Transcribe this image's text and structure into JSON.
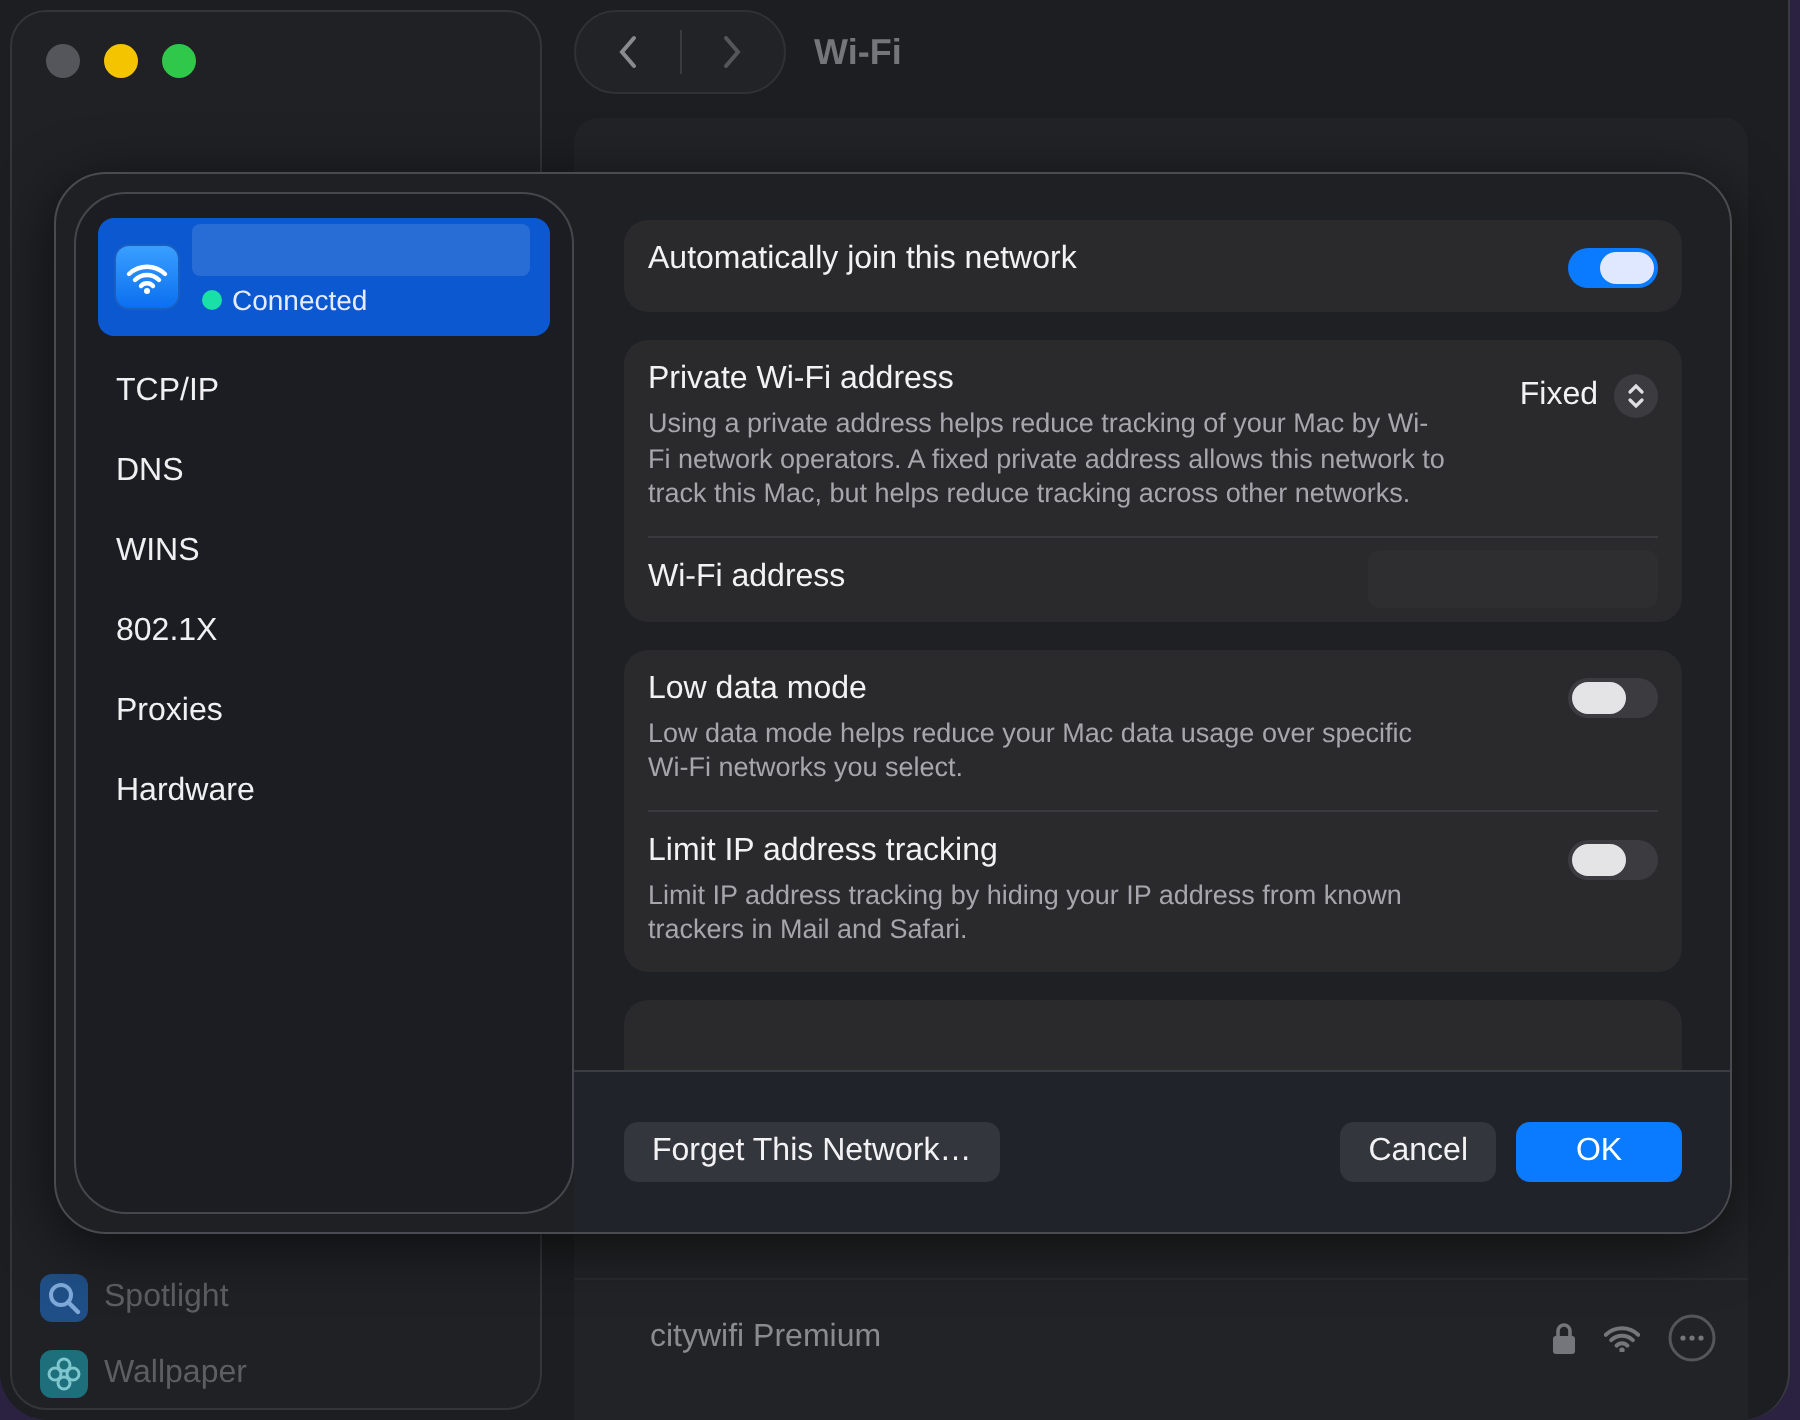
{
  "window": {
    "title": "Wi-Fi",
    "sidebar": {
      "items": [
        {
          "kind": "spotlight",
          "label": "Spotlight"
        },
        {
          "kind": "wallpaper",
          "label": "Wallpaper"
        }
      ]
    },
    "networks": [
      {
        "name": "citywifi Premium",
        "locked": true
      }
    ]
  },
  "sheet": {
    "sidebar": {
      "items": [
        {
          "kind": "network",
          "status": "Connected",
          "selected": true
        },
        {
          "kind": "tab",
          "label": "TCP/IP",
          "selected": false
        },
        {
          "kind": "tab",
          "label": "DNS",
          "selected": false
        },
        {
          "kind": "tab",
          "label": "WINS",
          "selected": false
        },
        {
          "kind": "tab",
          "label": "802.1X",
          "selected": false
        },
        {
          "kind": "tab",
          "label": "Proxies",
          "selected": false
        },
        {
          "kind": "tab",
          "label": "Hardware",
          "selected": false
        }
      ]
    },
    "groups": [
      {
        "rows": [
          {
            "kind": "toggle",
            "label": "Automatically join this network",
            "on": true
          }
        ]
      },
      {
        "rows": [
          {
            "kind": "popup",
            "label": "Private Wi-Fi address",
            "value": "Fixed",
            "description": "Using a private address helps reduce tracking of your Mac by Wi-Fi network operators. A fixed private address allows this network to track this Mac, but helps reduce tracking across other networks."
          },
          {
            "kind": "address",
            "label": "Wi-Fi address"
          }
        ]
      },
      {
        "rows": [
          {
            "kind": "toggle",
            "label": "Low data mode",
            "on": false,
            "description": "Low data mode helps reduce your Mac data usage over specific Wi-Fi networks you select."
          },
          {
            "kind": "toggle",
            "label": "Limit IP address tracking",
            "on": false,
            "description": "Limit IP address tracking by hiding your IP address from known trackers in Mail and Safari."
          }
        ]
      }
    ],
    "buttons": [
      {
        "kind": "secondary",
        "label": "Forget This Network…"
      },
      {
        "kind": "secondary",
        "label": "Cancel"
      },
      {
        "kind": "primary",
        "label": "OK"
      }
    ]
  }
}
